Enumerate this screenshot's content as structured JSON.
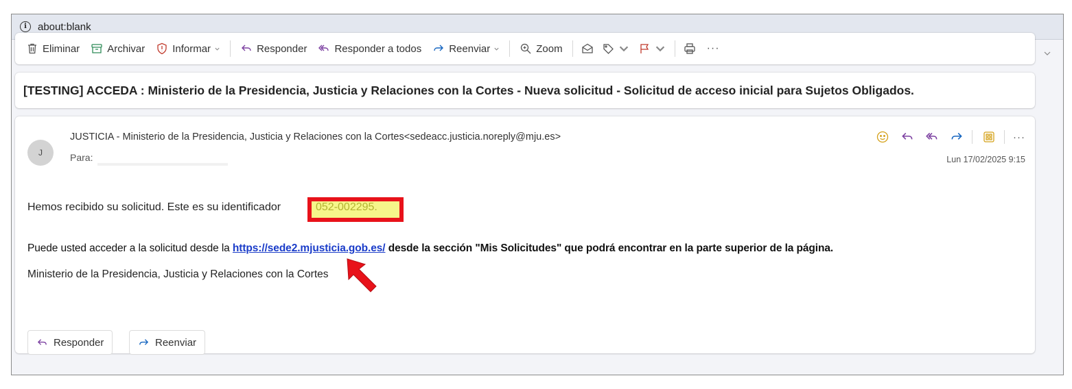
{
  "address_bar": {
    "url": "about:blank"
  },
  "toolbar": {
    "delete": "Eliminar",
    "archive": "Archivar",
    "report": "Informar",
    "reply": "Responder",
    "reply_all": "Responder a todos",
    "forward": "Reenviar",
    "zoom": "Zoom",
    "more": "···"
  },
  "subject": "[TESTING] ACCEDA : Ministerio de la Presidencia, Justicia y Relaciones con la Cortes - Nueva solicitud - Solicitud de acceso inicial para Sujetos Obligados.",
  "message": {
    "avatar_initial": "J",
    "sender": "JUSTICIA - Ministerio de la Presidencia, Justicia y Relaciones con la Cortes<sedeacc.justicia.noreply@mju.es>",
    "to_label": "Para:",
    "date": "Lun 17/02/2025 9:15",
    "more": "···",
    "body": {
      "line1": "Hemos recibido su solicitud. Este es su identificador",
      "identifier": "052-002295.",
      "line2_before": "Puede usted acceder a la solicitud desde la ",
      "line2_link": "https://sede2.mjusticia.gob.es/",
      "line2_after": " desde la sección \"Mis Solicitudes\" que podrá encontrar en la parte superior de la página.",
      "line3": "Ministerio de la Presidencia, Justicia y Relaciones con la Cortes"
    }
  },
  "footer": {
    "reply": "Responder",
    "forward": "Reenviar"
  },
  "colors": {
    "highlight_border": "#e8121a",
    "highlight_fill": "#f6f68a",
    "link": "#1a3cc9",
    "accent": "#c0392b"
  },
  "icons": [
    "info-icon",
    "trash-icon",
    "archive-icon",
    "shield-icon",
    "reply-icon",
    "reply-all-icon",
    "forward-icon",
    "zoom-icon",
    "envelope-icon",
    "tag-icon",
    "flag-icon",
    "print-icon",
    "emoji-icon",
    "apps-icon",
    "arrow-pointer"
  ]
}
